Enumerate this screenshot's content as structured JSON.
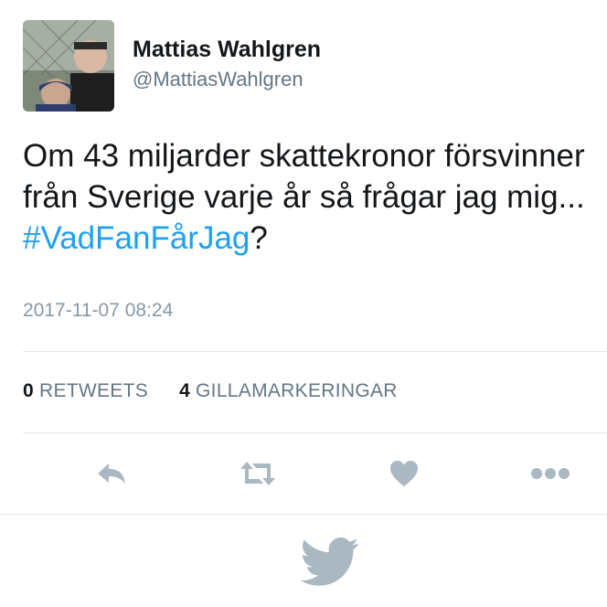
{
  "user": {
    "name": "Mattias Wahlgren",
    "handle": "@MattiasWahlgren"
  },
  "tweet": {
    "text_before": "Om 43 miljarder skattekronor försvinner från Sverige varje år så frågar jag mig... ",
    "hashtag": "#VadFanFårJag",
    "text_after": "?",
    "timestamp": "2017-11-07 08:24"
  },
  "stats": {
    "retweets_count": "0",
    "retweets_label": "RETWEETS",
    "likes_count": "4",
    "likes_label": "GILLAMARKERINGAR"
  },
  "icons": {
    "reply": "reply-icon",
    "retweet": "retweet-icon",
    "like": "heart-icon",
    "more": "more-icon",
    "brand": "twitter-bird-icon"
  },
  "colors": {
    "hashtag": "#1da1f2",
    "icon_gray": "#aab8c2",
    "bird_gray": "#aab8c2"
  }
}
